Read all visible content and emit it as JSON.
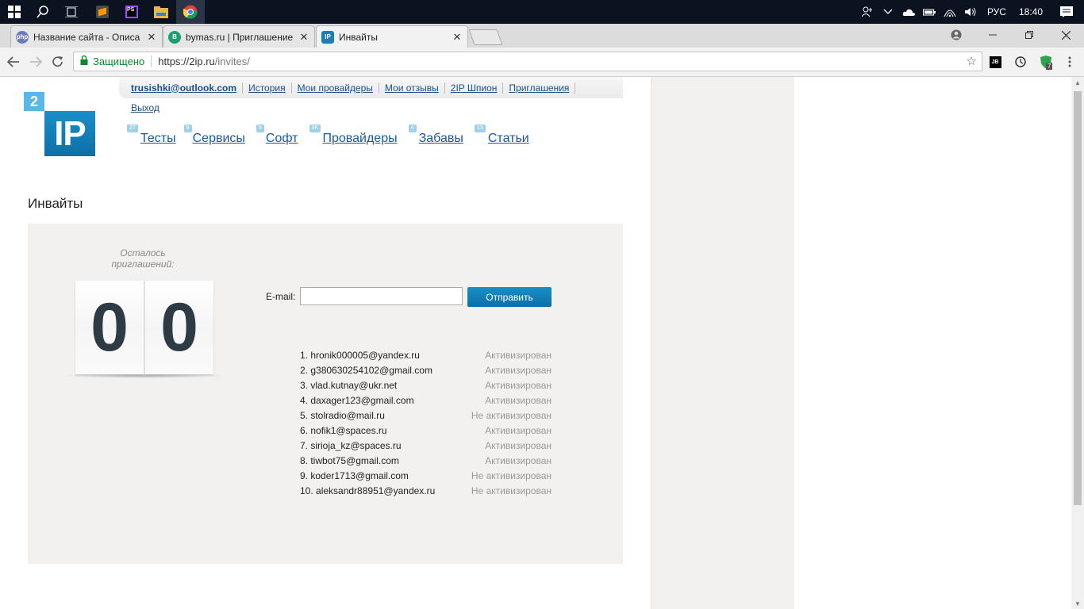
{
  "taskbar": {
    "clock": "18:40",
    "lang": "РУС",
    "apps": [
      "start-icon",
      "search-icon",
      "task-view-icon",
      "sublime-icon",
      "phpstorm-icon",
      "explorer-icon",
      "chrome-icon"
    ]
  },
  "browser": {
    "tabs": [
      {
        "title": "Название сайта - Описа",
        "favicon": "php",
        "active": false
      },
      {
        "title": "bymas.ru | Приглашение",
        "favicon": "B",
        "active": false
      },
      {
        "title": "Инвайты",
        "favicon": "IP",
        "active": true
      }
    ],
    "secure_label": "Защищено",
    "url_host": "https://2ip.ru",
    "url_path": "/invites/",
    "ext_badge": "7",
    "ext_jb": "JB"
  },
  "site": {
    "logo_number": "2",
    "logo_text": "IP",
    "topnav": {
      "user": "trusishki@outlook.com",
      "links": [
        "История",
        "Мои провайдеры",
        "Мои отзывы",
        "2IP Шпион",
        "Приглашения"
      ],
      "logout": "Выход"
    },
    "mainnav": [
      {
        "label": "Тесты",
        "badge": "27"
      },
      {
        "label": "Сервисы",
        "badge": "9"
      },
      {
        "label": "Софт",
        "badge": "5"
      },
      {
        "label": "Провайдеры",
        "badge": "3K"
      },
      {
        "label": "Забавы",
        "badge": "4"
      },
      {
        "label": "Статьи",
        "badge": "13"
      }
    ]
  },
  "invites_page": {
    "heading": "Инвайты",
    "counter_caption": "Осталось приглашений:",
    "digits": [
      "0",
      "0"
    ],
    "email_label": "E-mail:",
    "email_value": "",
    "send_label": "Отправить",
    "list": [
      {
        "email": "1. hronik000005@yandex.ru",
        "status": "Активизирован"
      },
      {
        "email": "2. g380630254102@gmail.com",
        "status": "Активизирован"
      },
      {
        "email": "3. vlad.kutnay@ukr.net",
        "status": "Активизирован"
      },
      {
        "email": "4. daxager123@gmail.com",
        "status": "Активизирован"
      },
      {
        "email": "5. stolradio@mail.ru",
        "status": "Не активизирован"
      },
      {
        "email": "6. nofik1@spaces.ru",
        "status": "Активизирован"
      },
      {
        "email": "7. sirioja_kz@spaces.ru",
        "status": "Активизирован"
      },
      {
        "email": "8. tiwbot75@gmail.com",
        "status": "Активизирован"
      },
      {
        "email": "9. koder1713@gmail.com",
        "status": "Не активизирован"
      },
      {
        "email": "10. aleksandr88951@yandex.ru",
        "status": "Не активизирован"
      }
    ]
  },
  "colors": {
    "link": "#1a4f8a",
    "accent": "#1a8fc8",
    "panel": "#f2f1ef",
    "secure": "#0a8a2a"
  }
}
